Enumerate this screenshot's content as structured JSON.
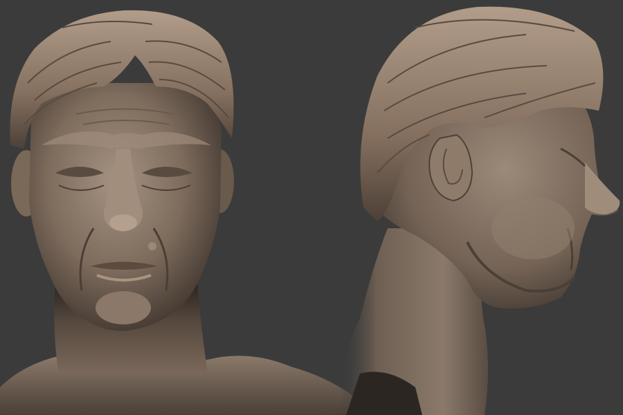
{
  "scene": {
    "background_color": "#3b3b3b",
    "material_color": "#8a7766",
    "views": [
      "front-view",
      "side-view"
    ]
  }
}
